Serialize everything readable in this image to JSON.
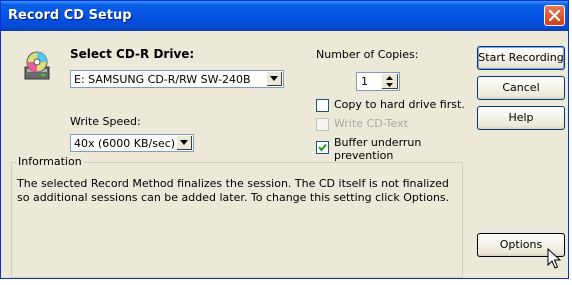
{
  "window": {
    "title": "Record CD Setup"
  },
  "drive": {
    "label": "Select CD-R Drive:",
    "selected": "E: SAMSUNG CD-R/RW SW-240B"
  },
  "speed": {
    "label": "Write Speed:",
    "selected": "40x (6000 KB/sec)"
  },
  "copies": {
    "label": "Number of Copies:",
    "value": "1"
  },
  "options": {
    "copy_hdd": {
      "label": "Copy to hard drive first.",
      "checked": false
    },
    "write_cdtext": {
      "label": "Write CD-Text",
      "checked": false,
      "disabled": true
    },
    "buffer_underrun": {
      "label_line1": "Buffer underrun",
      "label_line2": "prevention",
      "checked": true
    }
  },
  "buttons": {
    "start": "Start Recording",
    "cancel": "Cancel",
    "help": "Help",
    "options": "Options"
  },
  "info": {
    "title": "Information",
    "text": "The selected Record Method finalizes the session. The CD itself is not finalized so additional sessions can be added later. To change this setting click Options."
  },
  "icons": [
    "cd-drive-icon",
    "close-icon",
    "dropdown-arrow-icon",
    "spin-up-icon",
    "spin-down-icon",
    "checkmark-icon",
    "mouse-cursor-icon"
  ],
  "colors": {
    "titlebar": "#0554e3",
    "dialog_bg": "#ece9d8",
    "close_button": "#d23e17"
  }
}
